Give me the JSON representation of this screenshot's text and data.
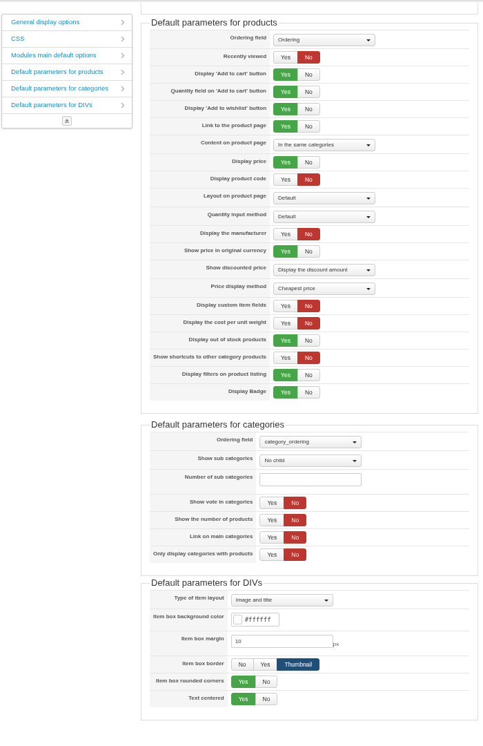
{
  "sidebar": {
    "items": [
      {
        "label": "General display options"
      },
      {
        "label": "CSS"
      },
      {
        "label": "Modules main default options"
      },
      {
        "label": "Default parameters for products"
      },
      {
        "label": "Default parameters for categories"
      },
      {
        "label": "Default parameters for DIVs"
      }
    ]
  },
  "sections": [
    {
      "title": "Default parameters for products",
      "rows": [
        {
          "label": "Ordering field",
          "kind": "select",
          "value": "Ordering"
        },
        {
          "label": "Recently viewed",
          "kind": "toggle",
          "options": [
            {
              "label": "Yes",
              "selected": false
            },
            {
              "label": "No",
              "kind": "negative",
              "selected": true
            }
          ]
        },
        {
          "label": "Display 'Add to cart' button",
          "kind": "toggle",
          "options": [
            {
              "label": "Yes",
              "kind": "positive",
              "selected": true
            },
            {
              "label": "No",
              "selected": false
            }
          ]
        },
        {
          "label": "Quantity field on 'Add to cart' button",
          "kind": "toggle",
          "options": [
            {
              "label": "Yes",
              "kind": "positive",
              "selected": true
            },
            {
              "label": "No",
              "selected": false
            }
          ]
        },
        {
          "label": "Display 'Add to wishlist' button",
          "kind": "toggle",
          "options": [
            {
              "label": "Yes",
              "kind": "positive",
              "selected": true
            },
            {
              "label": "No",
              "selected": false
            }
          ]
        },
        {
          "label": "Link to the product page",
          "kind": "toggle",
          "options": [
            {
              "label": "Yes",
              "kind": "positive",
              "selected": true
            },
            {
              "label": "No",
              "selected": false
            }
          ]
        },
        {
          "label": "Content on product page",
          "kind": "select",
          "value": "In the same categories"
        },
        {
          "label": "Display price",
          "kind": "toggle",
          "options": [
            {
              "label": "Yes",
              "kind": "positive",
              "selected": true
            },
            {
              "label": "No",
              "selected": false
            }
          ]
        },
        {
          "label": "Display product code",
          "kind": "toggle",
          "options": [
            {
              "label": "Yes",
              "selected": false
            },
            {
              "label": "No",
              "kind": "negative",
              "selected": true
            }
          ]
        },
        {
          "label": "Layout on product page",
          "kind": "select",
          "value": "Default"
        },
        {
          "label": "Quantity input method",
          "kind": "select",
          "value": "Default"
        },
        {
          "label": "Display the manufacturer",
          "kind": "toggle",
          "options": [
            {
              "label": "Yes",
              "selected": false
            },
            {
              "label": "No",
              "kind": "negative",
              "selected": true
            }
          ]
        },
        {
          "label": "Show price in original currency",
          "kind": "toggle",
          "options": [
            {
              "label": "Yes",
              "kind": "positive",
              "selected": true
            },
            {
              "label": "No",
              "selected": false
            }
          ]
        },
        {
          "label": "Show discounted price",
          "kind": "select",
          "value": "Display the discount amount"
        },
        {
          "label": "Price display method",
          "kind": "select",
          "value": "Cheapest price"
        },
        {
          "label": "Display custom item fields",
          "kind": "toggle",
          "options": [
            {
              "label": "Yes",
              "selected": false
            },
            {
              "label": "No",
              "kind": "negative",
              "selected": true
            }
          ]
        },
        {
          "label": "Display the cost per unit weight",
          "kind": "toggle",
          "options": [
            {
              "label": "Yes",
              "selected": false
            },
            {
              "label": "No",
              "kind": "negative",
              "selected": true
            }
          ]
        },
        {
          "label": "Display out of stock products",
          "kind": "toggle",
          "options": [
            {
              "label": "Yes",
              "kind": "positive",
              "selected": true
            },
            {
              "label": "No",
              "selected": false
            }
          ]
        },
        {
          "label": "Show shortcuts to other category products",
          "kind": "toggle",
          "options": [
            {
              "label": "Yes",
              "selected": false
            },
            {
              "label": "No",
              "kind": "negative",
              "selected": true
            }
          ]
        },
        {
          "label": "Display filters on product listing",
          "kind": "toggle",
          "options": [
            {
              "label": "Yes",
              "kind": "positive",
              "selected": true
            },
            {
              "label": "No",
              "selected": false
            }
          ]
        },
        {
          "label": "Display Badge",
          "kind": "toggle",
          "options": [
            {
              "label": "Yes",
              "kind": "positive",
              "selected": true
            },
            {
              "label": "No",
              "selected": false
            }
          ]
        }
      ]
    },
    {
      "title": "Default parameters for categories",
      "rows": [
        {
          "label": "Ordering field",
          "kind": "select",
          "value": "category_ordering"
        },
        {
          "label": "Show sub categories",
          "kind": "select",
          "value": "No child"
        },
        {
          "label": "Number of sub categories",
          "kind": "text"
        },
        {
          "label": "Show vote in categories",
          "kind": "toggle",
          "options": [
            {
              "label": "Yes",
              "selected": false
            },
            {
              "label": "No",
              "kind": "negative",
              "selected": true
            }
          ]
        },
        {
          "label": "Show the number of products",
          "kind": "toggle",
          "options": [
            {
              "label": "Yes",
              "selected": false
            },
            {
              "label": "No",
              "kind": "negative",
              "selected": true
            }
          ]
        },
        {
          "label": "Link on main categories",
          "kind": "toggle",
          "options": [
            {
              "label": "Yes",
              "selected": false
            },
            {
              "label": "No",
              "kind": "negative",
              "selected": true
            }
          ]
        },
        {
          "label": "Only display categories with products",
          "kind": "toggle",
          "options": [
            {
              "label": "Yes",
              "selected": false
            },
            {
              "label": "No",
              "kind": "negative",
              "selected": true
            }
          ]
        }
      ]
    },
    {
      "title": "Default parameters for DIVs",
      "rows": [
        {
          "label": "Type of item layout",
          "kind": "select",
          "value": "Image and title"
        },
        {
          "label": "Item box background color",
          "kind": "color",
          "value": "#ffffff"
        },
        {
          "label": "Item box margin",
          "kind": "text",
          "value": "10",
          "suffix": "px"
        },
        {
          "label": "Item box border",
          "kind": "toggle",
          "options": [
            {
              "label": "No",
              "selected": false
            },
            {
              "label": "Yes",
              "selected": false
            },
            {
              "label": "Thumbnail",
              "kind": "neutral",
              "selected": true
            }
          ]
        },
        {
          "label": "Item box rounded corners",
          "kind": "toggle",
          "options": [
            {
              "label": "Yes",
              "kind": "positive",
              "selected": true
            },
            {
              "label": "No",
              "selected": false
            }
          ]
        },
        {
          "label": "Text centered",
          "kind": "toggle",
          "options": [
            {
              "label": "Yes",
              "kind": "positive",
              "selected": true
            },
            {
              "label": "No",
              "selected": false
            }
          ]
        }
      ]
    }
  ]
}
